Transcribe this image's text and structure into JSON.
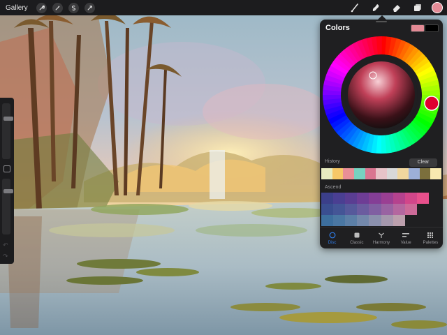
{
  "topbar": {
    "gallery_label": "Gallery",
    "left_tools": [
      {
        "name": "actions-wrench-icon"
      },
      {
        "name": "adjustments-wand-icon"
      },
      {
        "name": "selection-s-icon"
      },
      {
        "name": "transform-arrow-icon"
      }
    ],
    "right_tools": [
      {
        "name": "brush-icon"
      },
      {
        "name": "smudge-icon"
      },
      {
        "name": "eraser-icon"
      },
      {
        "name": "layers-icon"
      }
    ],
    "current_color": "#e38a95"
  },
  "sidebar": {
    "size_slider_value": 0.25,
    "opacity_slider_value": 0.2,
    "modify_button_icon": "square-icon",
    "undo_icon": "undo-arrow-icon",
    "redo_icon": "redo-arrow-icon"
  },
  "colors_panel": {
    "title": "Colors",
    "primary_color": "#e38a95",
    "secondary_color": "#000000",
    "history_label": "History",
    "clear_label": "Clear",
    "history": [
      "#e8ecc0",
      "#f6c868",
      "#e98f97",
      "#76d2c0",
      "#d97590",
      "#e7c3c8",
      "#d8d8d8",
      "#f0d69e",
      "#9db0d8",
      "#7b6f3c",
      "#f8e9b0"
    ],
    "palette_label": "Ascend",
    "palette": [
      [
        "#3b3f8a",
        "#4a3f92",
        "#5a3d92",
        "#6e3d95",
        "#843e96",
        "#9a3f93",
        "#b5428e",
        "#d2468a",
        "#e8508c"
      ],
      [
        "#3a4e90",
        "#445596",
        "#56599b",
        "#6b5c9f",
        "#805fa2",
        "#9963a2",
        "#b4679f",
        "#cc6a98",
        null
      ],
      [
        "#3d6f9e",
        "#4a77a3",
        "#5c7fa7",
        "#7388ab",
        "#8b90ad",
        "#a598ad",
        "#bca0ad",
        null,
        null
      ]
    ],
    "tabs": [
      {
        "label": "Disc",
        "icon": "disc-icon",
        "active": true
      },
      {
        "label": "Classic",
        "icon": "classic-square-icon",
        "active": false
      },
      {
        "label": "Harmony",
        "icon": "harmony-icon",
        "active": false
      },
      {
        "label": "Value",
        "icon": "value-sliders-icon",
        "active": false
      },
      {
        "label": "Palettes",
        "icon": "palettes-grid-icon",
        "active": false
      }
    ],
    "accent_color": "#2f7ce8"
  }
}
